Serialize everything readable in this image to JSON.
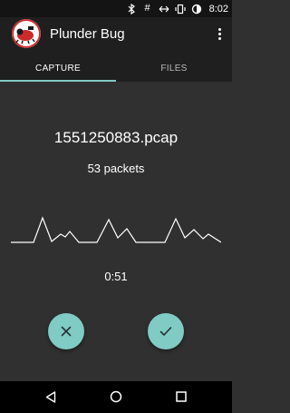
{
  "status_bar": {
    "time": "8:02",
    "icons": [
      "bluetooth-icon",
      "hashtag-icon",
      "data-transfer-icon",
      "vibrate-icon",
      "battery-icon"
    ]
  },
  "app_bar": {
    "title": "Plunder Bug",
    "logo_icon": "plunder-bug-logo"
  },
  "tabs": [
    {
      "label": "CAPTURE",
      "selected": true
    },
    {
      "label": "FILES",
      "selected": false
    }
  ],
  "capture": {
    "filename": "1551250883.pcap",
    "packets": "53 packets",
    "elapsed": "0:51"
  },
  "actions": {
    "discard_icon": "close-icon",
    "save_icon": "check-icon"
  },
  "navigation": {
    "icons": [
      "back-icon",
      "home-icon",
      "recents-icon"
    ]
  },
  "colors": {
    "accent": "#80cbc4",
    "background": "#303030",
    "toolbar": "#1f1f1f",
    "status_bar": "#141414"
  }
}
